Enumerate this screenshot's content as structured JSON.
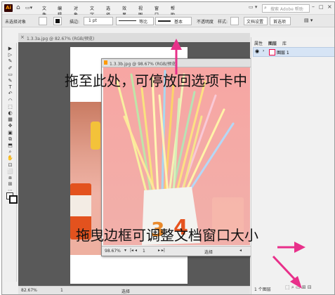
{
  "app": {
    "logo": "Ai"
  },
  "menu": [
    "文件(F)",
    "编辑(E)",
    "对象(O)",
    "文字(T)",
    "选择(S)",
    "效果(C)",
    "视图(V)",
    "窗口(W)",
    "帮助(H)"
  ],
  "search": {
    "placeholder": "搜索 Adobe 帮助"
  },
  "control_bar": {
    "selection": "未选择对象",
    "stroke_label": "描边:",
    "stroke_value": "1 pt",
    "stroke_style": "等比",
    "brush": "基本",
    "opacity_label": "不透明度",
    "style_label": "样式:",
    "doc_setup": "文档设置",
    "prefs": "首选项"
  },
  "doc_tab": {
    "title": "1.3.3a.jpg @ 82.67% (RGB/预览)"
  },
  "float_window": {
    "title": "1.3.3b.jpg @ 98.67% (RGB/预览)",
    "zoom": "98.67%",
    "page": "1",
    "mode": "选择"
  },
  "status": {
    "zoom": "82.67%",
    "page": "1",
    "mode": "选择"
  },
  "panel": {
    "tabs": [
      "属性",
      "图层",
      "库"
    ],
    "layer_name": "图层 1",
    "layer_count": "1 个图层"
  },
  "annotations": {
    "top": "拖至此处，可停放回选项卡中",
    "bottom": "拖曳边框可调整文档窗口大小"
  },
  "colors": {
    "accent_arrow": "#e8308a",
    "photo_bg": "#f6a3a0"
  }
}
